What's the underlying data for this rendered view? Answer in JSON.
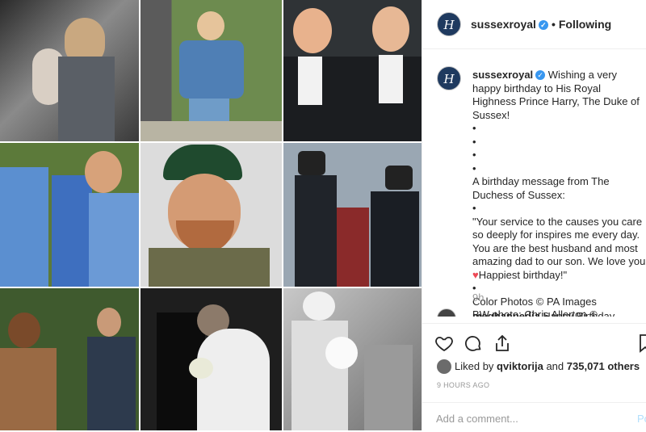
{
  "header": {
    "avatar_glyph": "H",
    "username": "sussexroyal",
    "verified_mark": "✓",
    "separator": "•",
    "follow_label": "Following"
  },
  "caption": {
    "username": "sussexroyal",
    "verified_mark": "✓",
    "line1": " Wishing a very happy birthday to His Royal Highness Prince Harry, The Duke of Sussex!",
    "bullets": "•\n•\n•\n•",
    "line2": "A birthday message from The Duchess of Sussex:",
    "bullet_a": "•",
    "quote": "\"Your service to the causes you care so deeply for inspires me every day. You are the best husband and most amazing dad to our son. We love you ",
    "heart": "♥",
    "quote_end": "Happiest birthday!\"",
    "bullet_b": "•",
    "credits": "Color Photos © PA Images\nBW photo: Chris Allerton ©\nSussexRoyal",
    "time": "9h"
  },
  "comment": {
    "username": "meghanpedia",
    "text": " Happy Birthday"
  },
  "actions": {
    "like_icon": "heart-outline-icon",
    "comment_icon": "comment-icon",
    "share_icon": "share-icon",
    "save_icon": "bookmark-icon",
    "liked_by_prefix": "Liked by ",
    "liked_by_user": "qviktorija",
    "liked_by_mid": " and ",
    "liked_by_count": "735,071 others",
    "ago": "9 HOURS AGO"
  },
  "add_comment": {
    "placeholder": "Add a comment...",
    "post_label": "Po"
  }
}
